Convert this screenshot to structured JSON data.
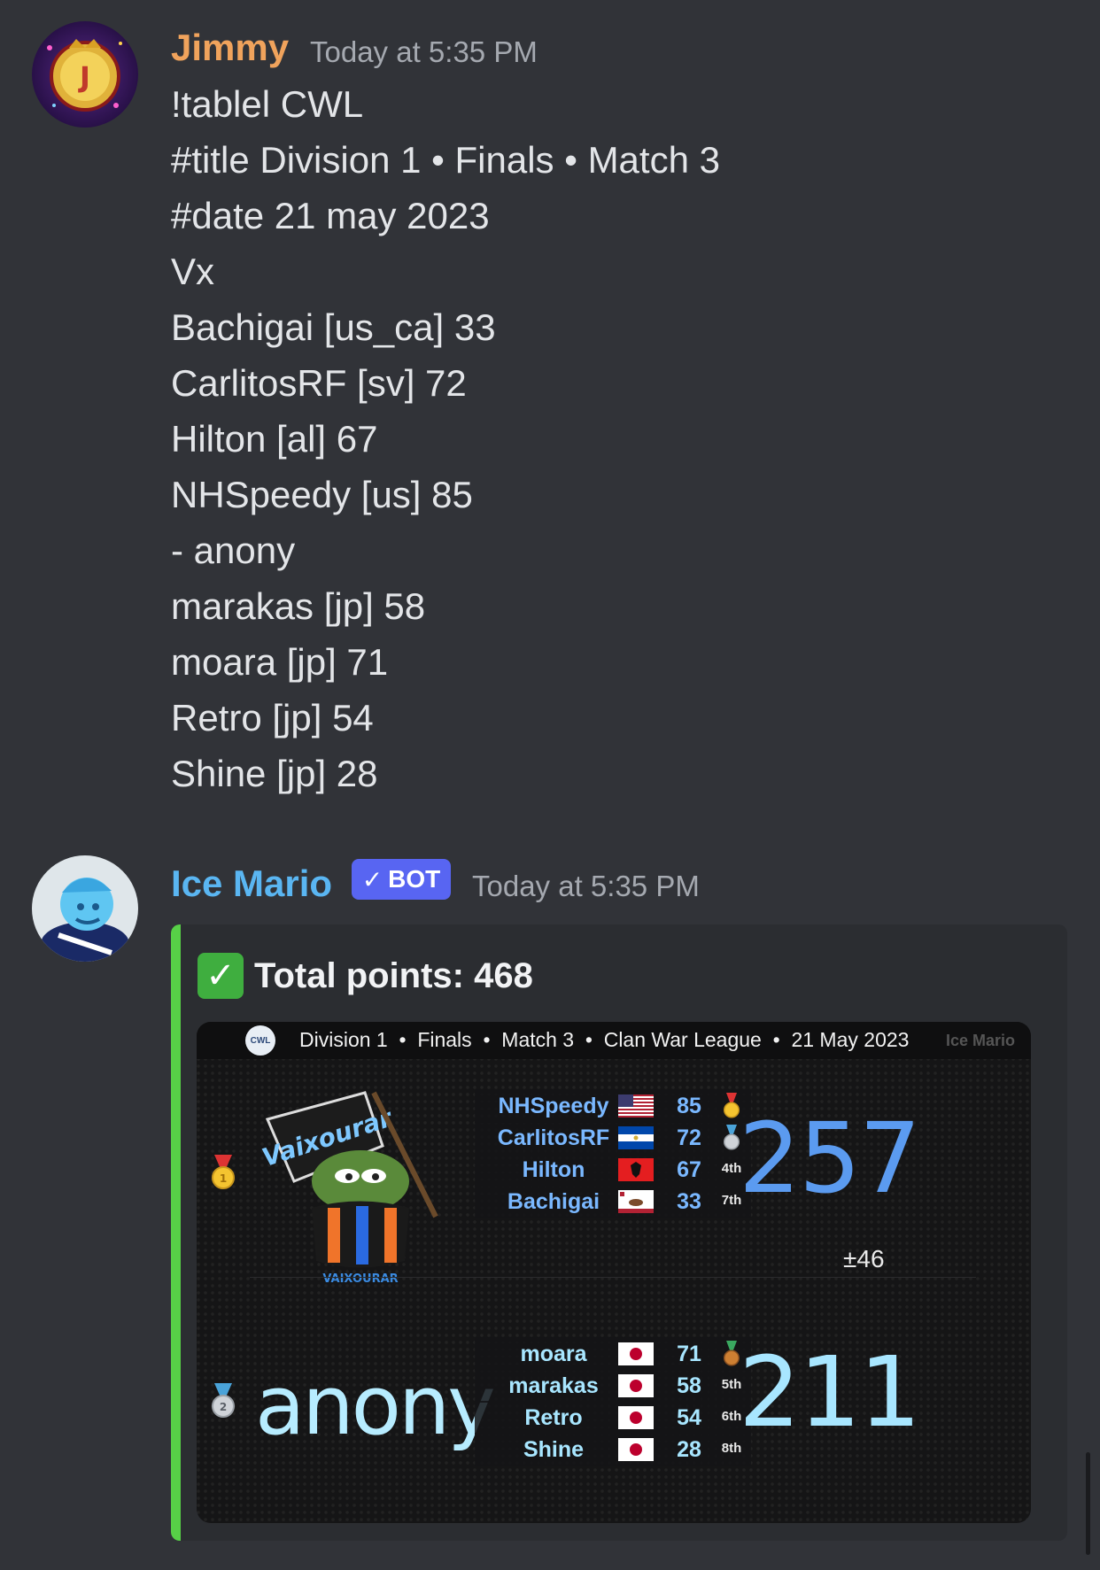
{
  "messages": [
    {
      "username": "Jimmy",
      "username_color": "#f0a35c",
      "timestamp": "Today at 5:35 PM",
      "lines": [
        "!tablel CWL",
        "#title Division 1 • Finals • Match 3",
        "#date 21 may 2023",
        "Vx",
        "Bachigai [us_ca] 33",
        "CarlitosRF [sv] 72",
        "Hilton [al] 67",
        "NHSpeedy [us] 85",
        "- anony",
        "marakas [jp] 58",
        "moara [jp] 71",
        "Retro [jp] 54",
        "Shine [jp] 28"
      ]
    },
    {
      "username": "Ice Mario",
      "username_color": "#5ab6f2",
      "bot_tag": "BOT",
      "timestamp": "Today at 5:35 PM"
    }
  ],
  "embed": {
    "accent_color": "#57d047",
    "title": "Total points: 468",
    "table": {
      "header_text": "Division 1  •  Finals  •  Match 3  •  Clan War League  •  21 May 2023",
      "header_logo": "CWL",
      "brand": "Ice Mario",
      "team1": {
        "logo_text": "Vaixourar",
        "logo_caption": "VAIXOURAR",
        "medal": "gold-medal",
        "total": "257",
        "total_color": "#5b9bf0",
        "players": [
          {
            "name": "NHSpeedy",
            "flag": "us",
            "score": "85",
            "rank": "gold-medal"
          },
          {
            "name": "CarlitosRF",
            "flag": "sv",
            "score": "72",
            "rank": "silver-medal"
          },
          {
            "name": "Hilton",
            "flag": "al",
            "score": "67",
            "rank": "4th"
          },
          {
            "name": "Bachigai",
            "flag": "us_ca",
            "score": "33",
            "rank": "7th"
          }
        ]
      },
      "difference": "±46",
      "team2": {
        "name": "anony",
        "medal": "silver-medal",
        "total": "211",
        "total_color": "#a8e6ff",
        "players": [
          {
            "name": "moara",
            "flag": "jp",
            "score": "71",
            "rank": "bronze-medal"
          },
          {
            "name": "marakas",
            "flag": "jp",
            "score": "58",
            "rank": "5th"
          },
          {
            "name": "Retro",
            "flag": "jp",
            "score": "54",
            "rank": "6th"
          },
          {
            "name": "Shine",
            "flag": "jp",
            "score": "28",
            "rank": "8th"
          }
        ]
      }
    }
  }
}
